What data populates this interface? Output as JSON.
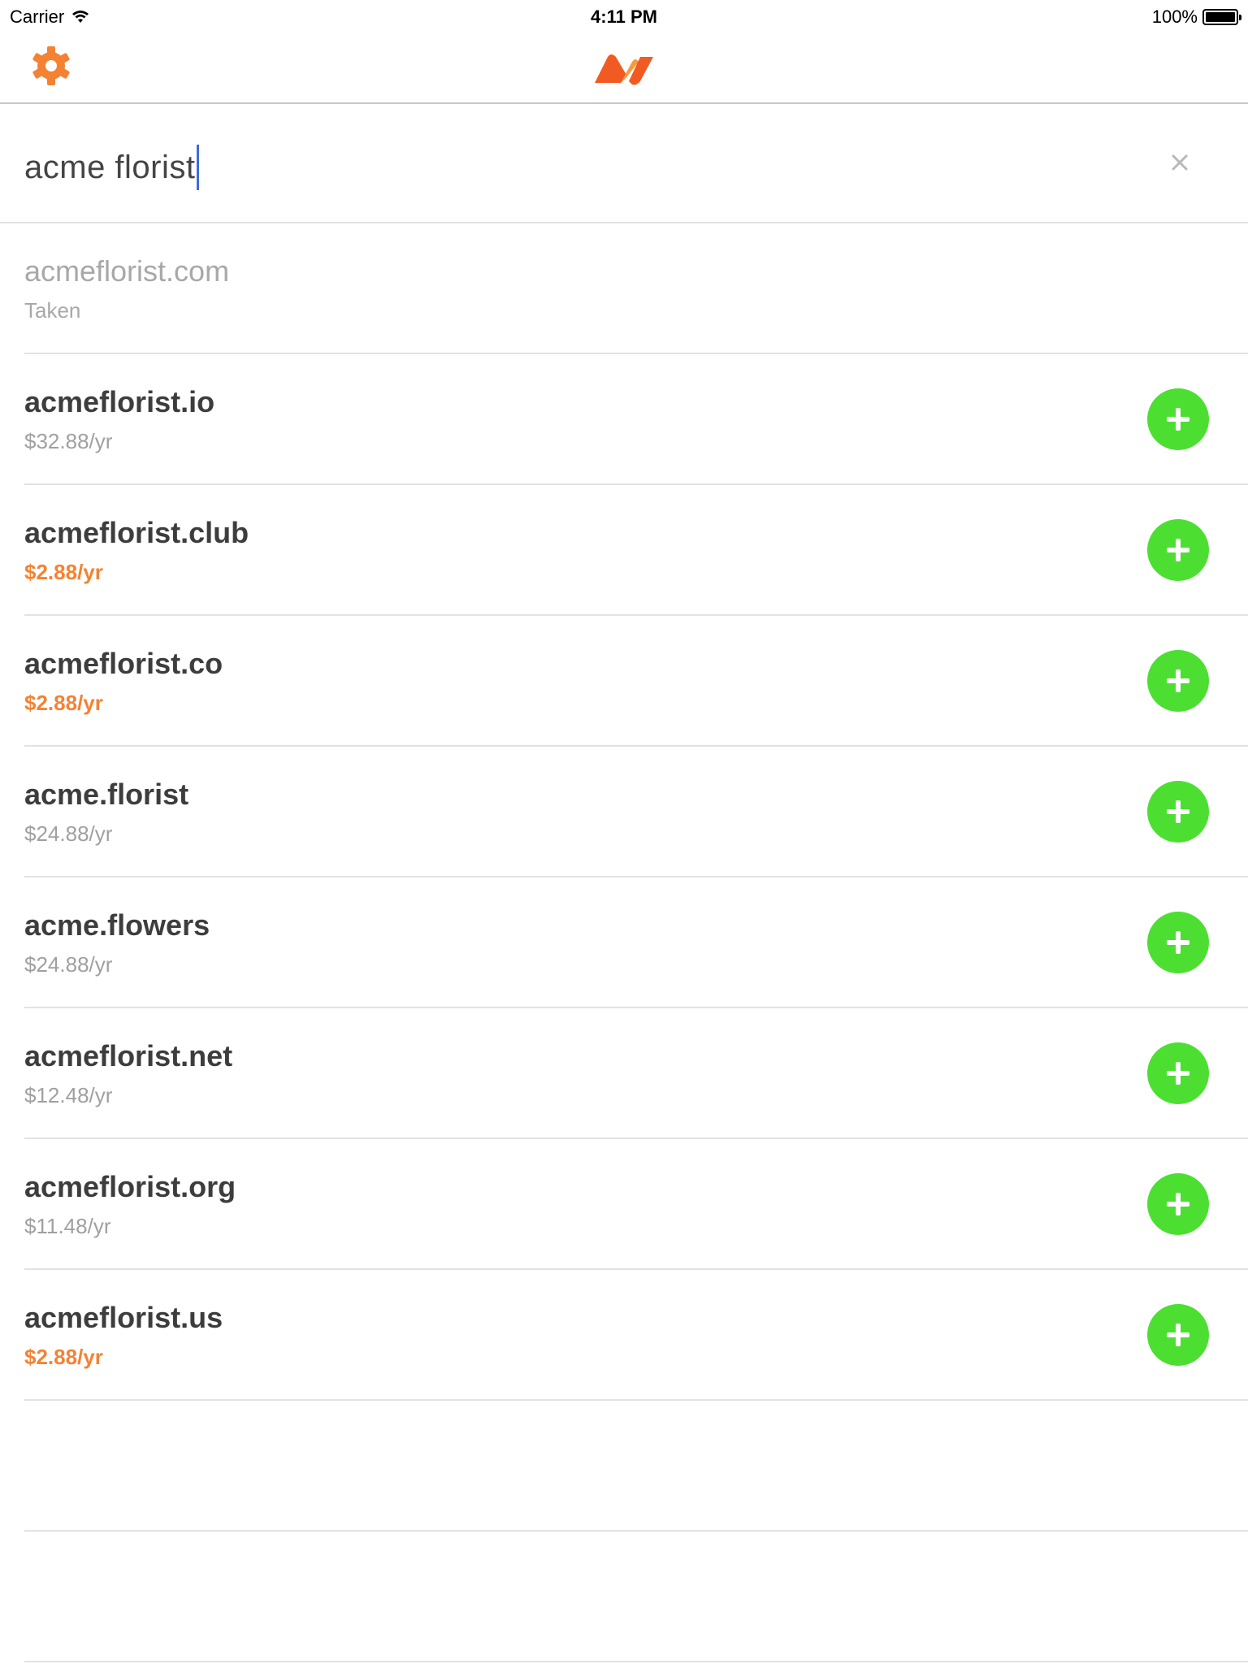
{
  "status_bar": {
    "carrier": "Carrier",
    "time": "4:11 PM",
    "battery": "100%"
  },
  "nav": {
    "settings_icon": "gear-icon",
    "logo_icon": "namecheap-logo"
  },
  "search": {
    "value": "acme florist",
    "clear_icon": "close-icon"
  },
  "results": [
    {
      "domain": "acmeflorist.com",
      "status": "Taken"
    },
    {
      "domain": "acmeflorist.io",
      "price": "$32.88/yr"
    },
    {
      "domain": "acmeflorist.club",
      "price": "$2.88/yr"
    },
    {
      "domain": "acmeflorist.co",
      "price": "$2.88/yr"
    },
    {
      "domain": "acme.florist",
      "price": "$24.88/yr"
    },
    {
      "domain": "acme.flowers",
      "price": "$24.88/yr"
    },
    {
      "domain": "acmeflorist.net",
      "price": "$12.48/yr"
    },
    {
      "domain": "acmeflorist.org",
      "price": "$11.48/yr"
    },
    {
      "domain": "acmeflorist.us",
      "price": "$2.88/yr"
    }
  ],
  "colors": {
    "accent_orange": "#f58232",
    "add_green": "#4cdf32",
    "caret_blue": "#3b6be6"
  }
}
